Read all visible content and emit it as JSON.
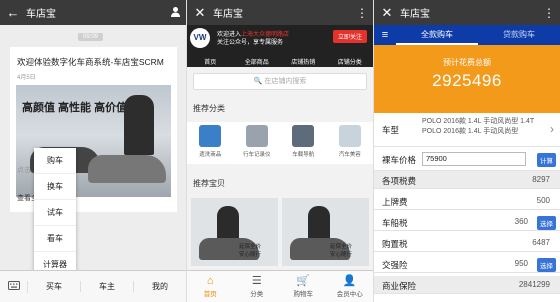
{
  "panel1": {
    "topbar": {
      "back_icon": "←",
      "title": "车店宝",
      "user_icon": "user-icon"
    },
    "timestamp": "09:09",
    "card": {
      "title": "欢迎体验数字化车商系统-车店宝SCRM",
      "date": "4月5日",
      "image_caption": "高颜值 高性能 高价值",
      "more1": "点击",
      "more2": "查看全"
    },
    "popup_menu": [
      "购车",
      "换车",
      "试车",
      "看车",
      "计算器"
    ],
    "bottom_bar": {
      "keyboard_icon": "keyboard-icon",
      "items": [
        "买车",
        "车主",
        "我的"
      ]
    }
  },
  "panel2": {
    "topbar": {
      "close_icon": "✕",
      "title": "车店宝",
      "more_icon": "⋮"
    },
    "banner": {
      "logo": "VW",
      "line1_prefix": "欢迎进入",
      "line1_highlight": "上海大众德明路店",
      "line2": "关注公众号，享专属服务",
      "button": "立即关注",
      "nav": [
        "首页",
        "全部商品",
        "店铺热销",
        "店铺分类"
      ]
    },
    "search_placeholder": "在店铺内搜索",
    "section_recommend_categories": "推荐分类",
    "categories": [
      {
        "label": "遗洗商品",
        "color": "#3a7fc7"
      },
      {
        "label": "行车记录仪",
        "color": "#9aa3ad"
      },
      {
        "label": "车载导航",
        "color": "#5d6b7a"
      },
      {
        "label": "汽车美容",
        "color": "#c9d3dc"
      }
    ],
    "section_recommend_products": "推荐宝贝",
    "products": [
      {
        "caption": "延保全价 安心随行"
      },
      {
        "caption": "延保全价 安心随行"
      }
    ],
    "tabbar": [
      {
        "label": "首页",
        "active": true
      },
      {
        "label": "分类",
        "active": false
      },
      {
        "label": "购物车",
        "active": false
      },
      {
        "label": "会员中心",
        "active": false
      }
    ]
  },
  "panel3": {
    "topbar": {
      "close_icon": "✕",
      "title": "车店宝",
      "more_icon": "⋮"
    },
    "tabs": [
      "全款购车",
      "贷款购车"
    ],
    "hero": {
      "label": "预计花费总额",
      "value": "2925496"
    },
    "model": {
      "label": "车型",
      "value": "POLO 2016款 1.4L 手动风尚型 1.4T POLO 2016款 1.4L 手动风尚型"
    },
    "price": {
      "label": "裸车价格",
      "value": "75900",
      "button": "计算"
    },
    "rows": [
      {
        "label": "各项税费",
        "value": "8297",
        "gray": true,
        "button": ""
      },
      {
        "label": "上牌费",
        "value": "500",
        "gray": false,
        "button": ""
      },
      {
        "label": "车船税",
        "value": "360",
        "gray": false,
        "button": "选择"
      },
      {
        "label": "购置税",
        "value": "6487",
        "gray": false,
        "button": ""
      },
      {
        "label": "交强险",
        "value": "950",
        "gray": false,
        "button": "选择"
      },
      {
        "label": "商业保险",
        "value": "2841299",
        "gray": true,
        "button": ""
      }
    ]
  }
}
